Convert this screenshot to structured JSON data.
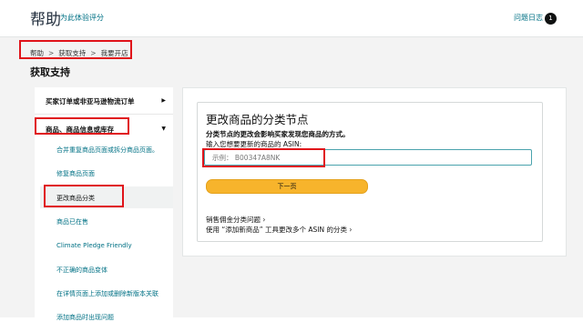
{
  "header": {
    "title": "帮助",
    "subtitle": "为此体验评分",
    "issue_log": "问题日志",
    "issue_count": "1"
  },
  "breadcrumb": {
    "items": [
      "帮助",
      "获取支持",
      "我要开店"
    ],
    "separator": ">"
  },
  "page_title": "获取支持",
  "sidebar": {
    "sections": [
      {
        "label": "买家订单或非亚马逊物流订单",
        "expanded": false,
        "arrow": "▶"
      },
      {
        "label": "商品、商品信息或库存",
        "expanded": true,
        "arrow": "▼"
      }
    ],
    "items": [
      "合并重复商品页面或拆分商品页面。",
      "修复商品页面",
      "更改商品分类",
      "商品已在售",
      "Climate Pledge Friendly",
      "不正确的商品变体",
      "在详情页面上添加或删除新版本关联",
      "添加商品时出现问题"
    ],
    "active_index": 2
  },
  "form": {
    "title": "更改商品的分类节点",
    "description": "分类节点的更改会影响买家发现您商品的方式。",
    "input_label": "输入您想要更新的商品的 ASIN:",
    "input_placeholder": "示例： B00347A8NK",
    "next_button": "下一页",
    "link_1": "销售佣金分类问题 ›",
    "link_2": "使用 “添加新商品” 工具更改多个 ASIN 的分类 ›"
  },
  "colors": {
    "highlight_red": "#e0131a",
    "link_teal": "#007185",
    "button_yellow": "#f7b42c"
  }
}
